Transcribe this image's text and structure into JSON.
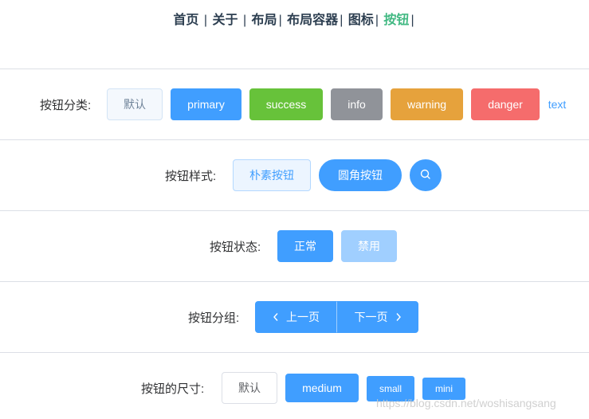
{
  "nav": {
    "items": [
      {
        "label": "首页",
        "active": false
      },
      {
        "label": "关于",
        "active": false
      },
      {
        "label": "布局",
        "active": false
      },
      {
        "label": "布局容器",
        "active": false
      },
      {
        "label": "图标",
        "active": false
      },
      {
        "label": "按钮",
        "active": true
      }
    ],
    "separator": "|"
  },
  "sections": {
    "types": {
      "label": "按钮分类:",
      "buttons": [
        "默认",
        "primary",
        "success",
        "info",
        "warning",
        "danger",
        "text"
      ]
    },
    "styles": {
      "label": "按钮样式:",
      "plain": "朴素按钮",
      "round": "圆角按钮",
      "circle_icon": "search-icon"
    },
    "states": {
      "label": "按钮状态:",
      "normal": "正常",
      "disabled": "禁用"
    },
    "group": {
      "label": "按钮分组:",
      "prev": "上一页",
      "next": "下一页",
      "prev_icon": "chevron-left-icon",
      "next_icon": "chevron-right-icon"
    },
    "sizes": {
      "label": "按钮的尺寸:",
      "buttons": [
        "默认",
        "medium",
        "small",
        "mini"
      ]
    }
  },
  "colors": {
    "primary": "#409eff",
    "success": "#67c23a",
    "info": "#909399",
    "warning": "#e6a23c",
    "danger": "#f56c6c",
    "nav_active": "#42b983",
    "nav_text": "#2c3e50"
  },
  "watermark": "https://blog.csdn.net/woshisangsang"
}
